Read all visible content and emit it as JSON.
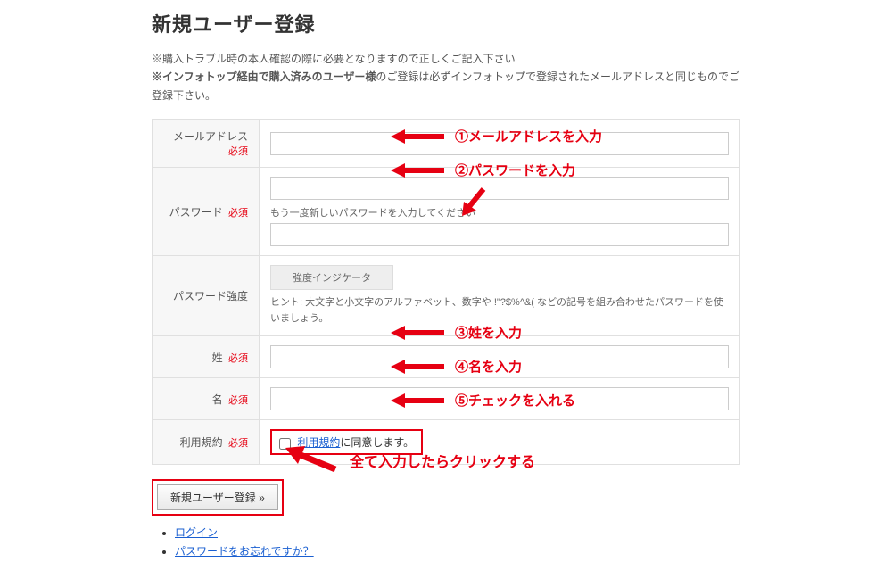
{
  "page": {
    "title": "新規ユーザー登録"
  },
  "notes": {
    "line1_prefix": "※購入トラブル時の本人確認の際に必要となりますので正しくご記入下さい",
    "line2_bold": "※インフォトップ経由で購入済みのユーザー様",
    "line2_rest": "のご登録は必ずインフォトップで登録されたメールアドレスと同じものでご登録下さい。"
  },
  "labels": {
    "email": "メールアドレス",
    "password": "パスワード",
    "password_strength": "パスワード強度",
    "lastname": "姓",
    "firstname": "名",
    "terms": "利用規約",
    "required": "必須"
  },
  "placeholders": {
    "password_confirm": "もう一度新しいパスワードを入力してください"
  },
  "strength": {
    "indicator": "強度インジケータ",
    "hint": "ヒント: 大文字と小文字のアルファベット、数字や !\"?$%^&( などの記号を組み合わせたパスワードを使いましょう。"
  },
  "terms": {
    "link_text": "利用規約",
    "agree_suffix": "に同意します。"
  },
  "submit": {
    "button": "新規ユーザー登録 »"
  },
  "links": {
    "login": "ログイン",
    "forgot": "パスワードをお忘れですか？"
  },
  "annotations": {
    "a1": "①メールアドレスを入力",
    "a2": "②パスワードを入力",
    "a3": "③姓を入力",
    "a4": "④名を入力",
    "a5": "⑤チェックを入れる",
    "a_submit": "全て入力したらクリックする"
  }
}
